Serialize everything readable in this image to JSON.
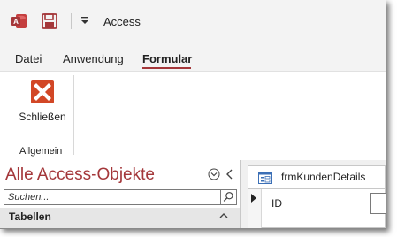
{
  "titlebar": {
    "app_icon": "access-app-icon",
    "save_icon": "save-icon",
    "qat_dropdown_icon": "customize-toolbar-dropdown-icon",
    "title": "Access"
  },
  "ribbon": {
    "tabs": [
      {
        "label": "Datei",
        "active": false
      },
      {
        "label": "Anwendung",
        "active": false
      },
      {
        "label": "Formular",
        "active": true
      }
    ],
    "groups": [
      {
        "label": "Allgemein",
        "buttons": [
          {
            "label": "Schließen",
            "icon": "close-x-icon",
            "icon_color": "#d24726"
          }
        ]
      }
    ]
  },
  "nav_pane": {
    "title": "Alle Access-Objekte",
    "title_color": "#a4373a",
    "menu_icon": "nav-menu-chevron-circle-icon",
    "collapse_icon": "collapse-chevron-left-icon",
    "search_placeholder": "Suchen...",
    "search_icon": "search-icon",
    "sections": [
      {
        "label": "Tabellen",
        "icon": "chevron-up-icon"
      }
    ]
  },
  "document": {
    "tabs": [
      {
        "label": "frmKundenDetails",
        "icon": "form-icon"
      }
    ],
    "fields": [
      {
        "label": "ID",
        "value": ""
      }
    ]
  },
  "colors": {
    "accent": "#a4373a",
    "titlebar_bg": "#f3f3f3",
    "close_icon": "#d24726"
  }
}
